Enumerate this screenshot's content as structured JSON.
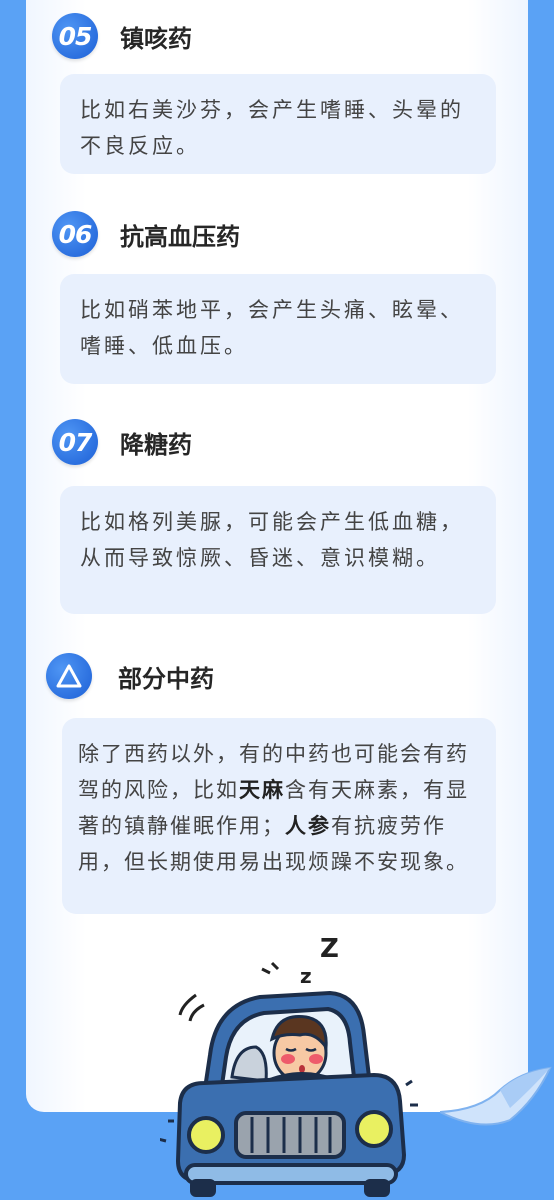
{
  "sections": [
    {
      "number": "05",
      "title": "镇咳药",
      "body": "比如右美沙芬，会产生嗜睡、头晕的不良反应。"
    },
    {
      "number": "06",
      "title": "抗高血压药",
      "body": "比如硝苯地平，会产生头痛、眩晕、嗜睡、低血压。"
    },
    {
      "number": "07",
      "title": "降糖药",
      "body": "比如格列美脲，可能会产生低血糖，从而导致惊厥、昏迷、意识模糊。"
    }
  ],
  "herbal": {
    "title": "部分中药",
    "text1": "除了西药以外，有的中药也可能会有药驾的风险，比如",
    "highlight1": "天麻",
    "text2": "含有天麻素，有显著的镇静催眠作用；",
    "highlight2": "人参",
    "text3": "有抗疲劳作用，但长期使用易出现烦躁不安现象。"
  },
  "illustration": {
    "zzz": "Z z",
    "icon": "sleepy-driver-car"
  },
  "colors": {
    "background": "#5aa2f5",
    "badge": "#1c5fd6",
    "card": "#e8f0fd",
    "car": "#3b6fb0"
  }
}
